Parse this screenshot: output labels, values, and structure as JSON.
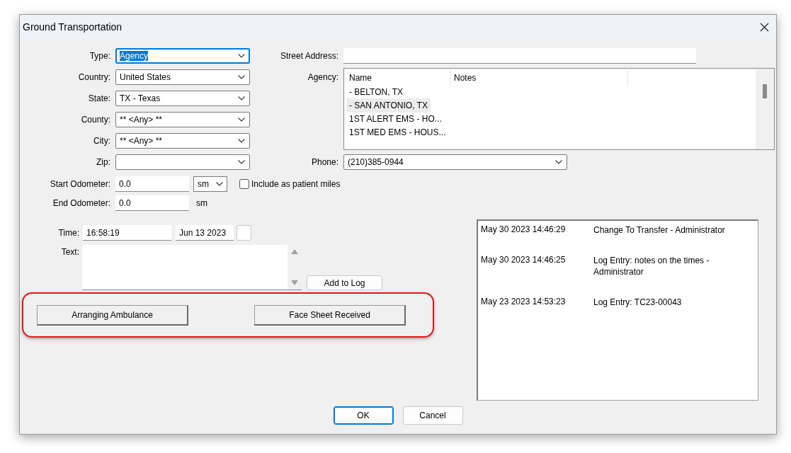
{
  "window": {
    "title": "Ground Transportation"
  },
  "left_fields": [
    {
      "label": "Type:",
      "value": "Agency",
      "focused": true
    },
    {
      "label": "Country:",
      "value": "United States",
      "focused": false
    },
    {
      "label": "State:",
      "value": "TX - Texas",
      "focused": false
    },
    {
      "label": "County:",
      "value": "** <Any> **",
      "focused": false
    },
    {
      "label": "City:",
      "value": "** <Any> **",
      "focused": false
    },
    {
      "label": "Zip:",
      "focused": false
    }
  ],
  "street_address": {
    "label": "Street Address:"
  },
  "agency": {
    "label": "Agency:",
    "columns": [
      "Name",
      "Notes"
    ],
    "rows": [
      {
        "name": "- BELTON, TX",
        "selected": false
      },
      {
        "name": "- SAN ANTONIO, TX",
        "selected": true
      },
      {
        "name": "1ST ALERT EMS - HO...",
        "selected": false
      },
      {
        "name": "1ST MED EMS - HOUS...",
        "selected": false
      }
    ]
  },
  "phone": {
    "label": "Phone:",
    "value": "(210)385-0944"
  },
  "start_odometer": {
    "label": "Start Odometer:",
    "value": "0.0",
    "unit": "sm"
  },
  "include_patient_miles": {
    "label": "Include as patient miles",
    "checked": false
  },
  "end_odometer": {
    "label": "End Odometer:",
    "value": "0.0",
    "unit": "sm"
  },
  "time": {
    "label": "Time:",
    "value": "16:58:19",
    "date": "Jun 13 2023"
  },
  "text": {
    "label": "Text:"
  },
  "add_to_log": "Add to Log",
  "highlighted_buttons": [
    "Arranging Ambulance",
    "Face Sheet Received"
  ],
  "log": [
    {
      "timestamp": "May 30 2023 14:46:29",
      "entry": "Change To Transfer - Administrator"
    },
    {
      "timestamp": "May 30 2023 14:46:25",
      "entry": "Log Entry: notes on the times - Administrator"
    },
    {
      "timestamp": "May 23 2023 14:53:23",
      "entry": "Log Entry: TC23-00043"
    }
  ],
  "buttons": [
    {
      "label": "OK",
      "default": true
    },
    {
      "label": "Cancel",
      "default": false
    }
  ]
}
